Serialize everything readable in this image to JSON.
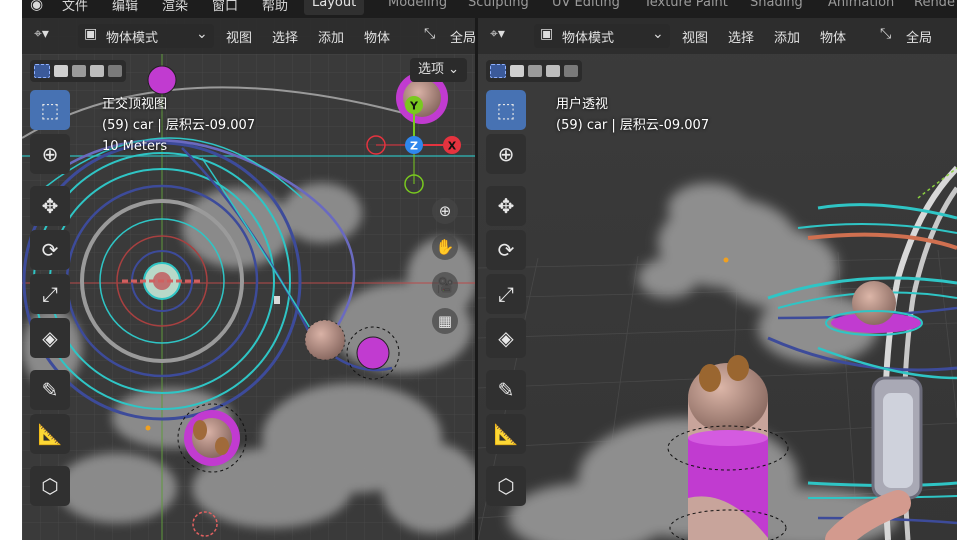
{
  "topbar": {
    "menus": [
      "文件",
      "编辑",
      "渲染",
      "窗口",
      "帮助"
    ],
    "workspaces": [
      "Layout",
      "Modeling",
      "Sculpting",
      "UV Editing",
      "Texture Paint",
      "Shading",
      "Animation",
      "Rende"
    ]
  },
  "left_view": {
    "mode_label": "物体模式",
    "menus": [
      "视图",
      "选择",
      "添加",
      "物体"
    ],
    "transform_label": "全局",
    "options_label": "选项",
    "info_title": "正交顶视图",
    "info_object": "(59) car | 层积云-09.007",
    "info_scale": "10 Meters",
    "gizmo": {
      "y": "Y",
      "z": "Z",
      "x": "X"
    }
  },
  "right_view": {
    "mode_label": "物体模式",
    "menus": [
      "视图",
      "选择",
      "添加",
      "物体"
    ],
    "transform_label": "全局",
    "info_title": "用户透视",
    "info_object": "(59) car | 层积云-09.007"
  },
  "colors": {
    "header_bg": "#2d2d2d",
    "tool_active": "#4772b3",
    "gizmo_x": "#e5333f",
    "gizmo_y": "#79c91f",
    "gizmo_z": "#2f87ed",
    "magenta": "#c13bd0",
    "cyan_track": "#2fc5c5"
  }
}
